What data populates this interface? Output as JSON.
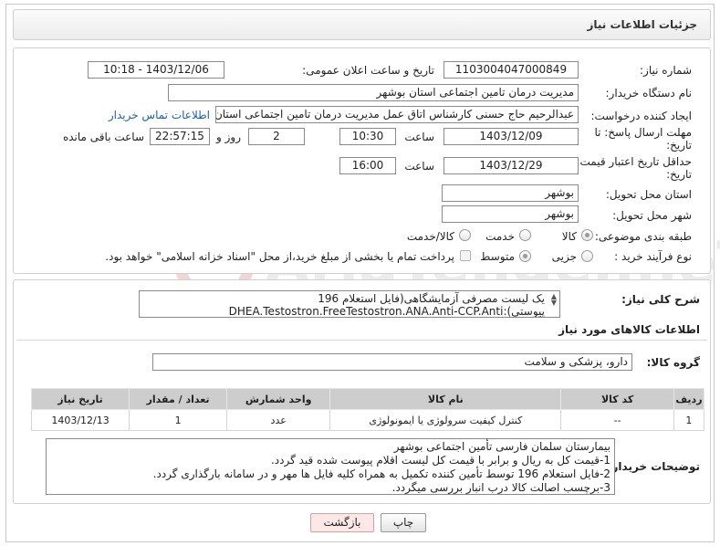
{
  "header": {
    "title": "جزئیات اطلاعات نیاز"
  },
  "fields": {
    "need_number_label": "شماره نیاز:",
    "need_number": "1103004047000849",
    "announce_label": "تاریخ و ساعت اعلان عمومی:",
    "announce_value": "1403/12/06 - 10:18",
    "buyer_org_label": "نام دستگاه خریدار:",
    "buyer_org": "مدیریت درمان تامین اجتماعی استان بوشهر",
    "creator_label": "ایجاد کننده درخواست:",
    "creator": "عبدالرحیم حاج حسنی کارشناس اتاق عمل مدیریت درمان تامین اجتماعی استان بوشهر",
    "contact_link": "اطلاعات تماس خریدار",
    "deadline_label_1": "مهلت ارسال پاسخ: تا",
    "deadline_label_2": "تاریخ:",
    "deadline_date": "1403/12/09",
    "time_label": "ساعت",
    "deadline_time": "10:30",
    "days_value": "2",
    "days_label": "روز و",
    "remaining_value": "22:57:15",
    "remaining_label": "ساعت باقی مانده",
    "validity_label_1": "حداقل تاریخ اعتبار قیمت: تا",
    "validity_label_2": "تاریخ:",
    "validity_date": "1403/12/29",
    "validity_time": "16:00",
    "province_label": "استان محل تحویل:",
    "province": "بوشهر",
    "city_label": "شهر محل تحویل:",
    "city": "بوشهر",
    "category_label": "طبقه بندی موضوعی:",
    "category_options": [
      "کالا",
      "خدمت",
      "کالا/خدمت"
    ],
    "process_label": "نوع فرآیند خرید :",
    "process_options": [
      "جزیی",
      "متوسط"
    ],
    "payment_note": "پرداخت تمام یا بخشی از مبلغ خرید،از محل \"اسناد خزانه اسلامی\" خواهد بود."
  },
  "description": {
    "label": "شرح کلی نیاز:",
    "text": "یک لیست مصرفی آزمایشگاهی(فایل استعلام 196 پیوستی):DHEA.Testostron.FreeTestostron.ANA.Anti-CCP.Anti"
  },
  "goods": {
    "section_title": "اطلاعات کالاهای مورد نیاز",
    "group_label": "گروه کالا:",
    "group_value": "دارو، پزشکی و سلامت",
    "columns": [
      "ردیف",
      "کد کالا",
      "نام کالا",
      "واحد شمارش",
      "تعداد / مقدار",
      "تاریخ نیاز"
    ],
    "rows": [
      [
        "1",
        "--",
        "کنترل کیفیت سرولوژی یا ایمونولوژی",
        "عدد",
        "1",
        "1403/12/13"
      ]
    ]
  },
  "buyer_notes": {
    "label": "توضیحات خریدار:",
    "lines": [
      "بیمارستان سلمان فارسی تأمین اجتماعی بوشهر",
      "1-قیمت کل به ریال و برابر با قیمت کل لیست اقلام پیوست شده قید گردد.",
      "2-فایل استعلام 196 توسط تأمین کننده تکمیل به همراه کلیه فایل ها مهر و در سامانه بارگذاری گردد.",
      "3-برچسب اصالت کالا درب انبار بررسی میگردد."
    ]
  },
  "buttons": {
    "print": "چاپ",
    "back": "بازگشت"
  },
  "colors": {
    "link": "#1a5fb4",
    "table_header": "#cdcdcd",
    "back_button": "#fde8e8"
  }
}
